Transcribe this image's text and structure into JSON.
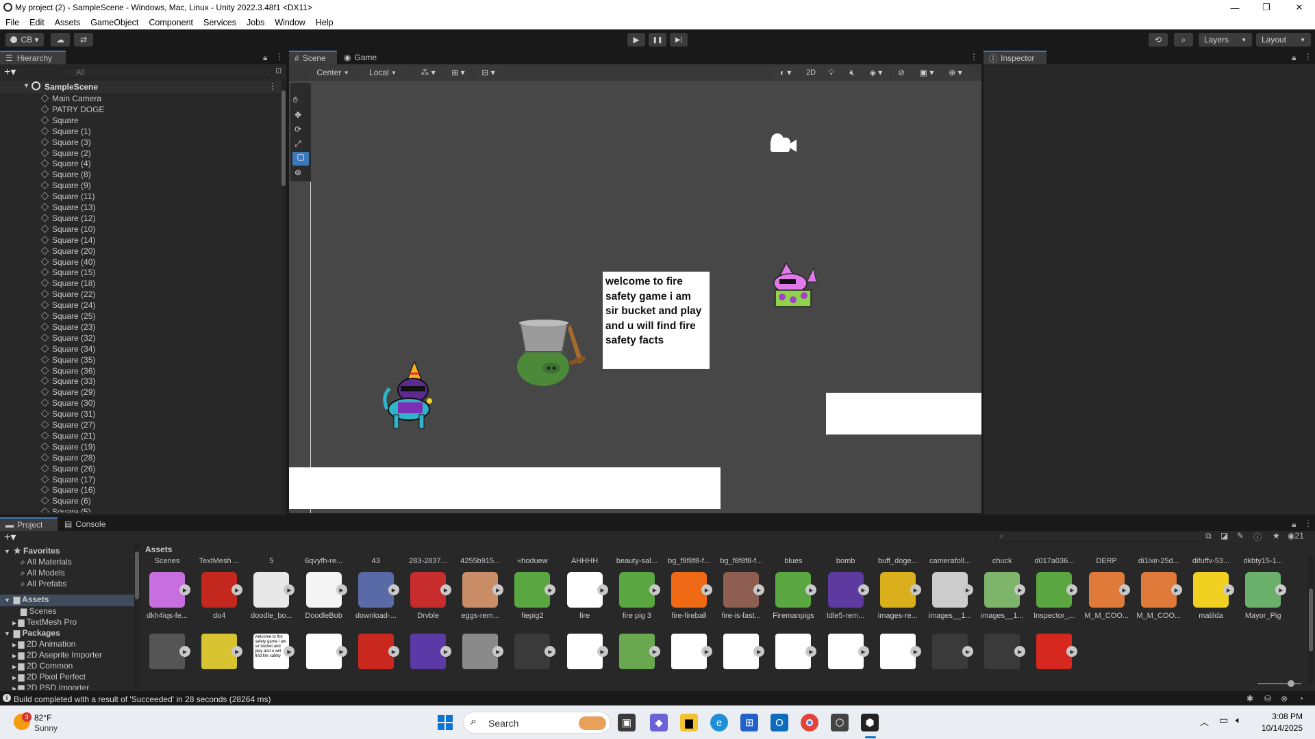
{
  "window": {
    "title": "My project (2) - SampleScene - Windows, Mac, Linux - Unity 2022.3.48f1 <DX11>",
    "minimize": "—",
    "maximize": "❐",
    "close": "✕"
  },
  "menu": [
    "File",
    "Edit",
    "Assets",
    "GameObject",
    "Component",
    "Services",
    "Jobs",
    "Window",
    "Help"
  ],
  "toolbar": {
    "account": "CB ▾",
    "cloud": "☁",
    "collab": "⇄",
    "play": "▶",
    "pause": "❚❚",
    "step": "▶|",
    "history": "⟲",
    "search": "⌕",
    "layers": "Layers",
    "layout": "Layout"
  },
  "hierarchy": {
    "tab": "Hierarchy",
    "search_placeholder": "All",
    "scene": "SampleScene",
    "items": [
      "Main Camera",
      "PATRY DOGE",
      "Square",
      "Square (1)",
      "Square (3)",
      "Square (2)",
      "Square (4)",
      "Square (8)",
      "Square (9)",
      "Square (11)",
      "Square (13)",
      "Square (12)",
      "Square (10)",
      "Square (14)",
      "Square (20)",
      "Square (40)",
      "Square (15)",
      "Square (18)",
      "Square (22)",
      "Square (24)",
      "Square (25)",
      "Square (23)",
      "Square (32)",
      "Square (34)",
      "Square (35)",
      "Square (36)",
      "Square (33)",
      "Square (29)",
      "Square (30)",
      "Square (31)",
      "Square (27)",
      "Square (21)",
      "Square (19)",
      "Square (28)",
      "Square (26)",
      "Square (17)",
      "Square (16)",
      "Square (6)",
      "Square (5)"
    ]
  },
  "scene_view": {
    "tab_scene": "Scene",
    "tab_game": "Game",
    "pivot": "Center",
    "space": "Local",
    "mode2d": "2D",
    "textbox": "welcome to fire safety game i am sir bucket and play and u will find fire safety facts"
  },
  "inspector": {
    "tab": "Inspector"
  },
  "project": {
    "tab_project": "Project",
    "tab_console": "Console",
    "breadcrumb": "Assets",
    "favorites": {
      "title": "Favorites",
      "items": [
        "All Materials",
        "All Models",
        "All Prefabs"
      ]
    },
    "assets_tree": {
      "title": "Assets",
      "items": [
        "Scenes",
        "TextMesh Pro"
      ]
    },
    "packages": {
      "title": "Packages",
      "items": [
        "2D Animation",
        "2D Aseprite Importer",
        "2D Common",
        "2D Pixel Perfect",
        "2D PSD Importer"
      ]
    },
    "top_labels": [
      "Scenes",
      "TextMesh ...",
      "5",
      "6qvyfh-re...",
      "43",
      "283-2837...",
      "4255b915...",
      "«hoduew",
      "AHHHH",
      "beauty-sal...",
      "bg_f8f8f8-f...",
      "bg_f8f8f8-f...",
      "blues",
      "bomb",
      "buff_doge...",
      "camerafoll...",
      "chuck",
      "d017a036...",
      "DERP",
      "di1ixir-25d...",
      "difuffv-53...",
      "dkbty15-1..."
    ],
    "row1": [
      "dkh4iqs-fe...",
      "do4",
      "doodle_bo...",
      "DoodleBob",
      "download-...",
      "Drvble",
      "eggs-rem...",
      "fiepig2",
      "fire",
      "fire pig 3",
      "fire-fireball",
      "fire-is-fast...",
      "Firemanpigs",
      "Idle5-rem...",
      "images-re...",
      "images__1...",
      "images__1...",
      "Inspector_...",
      "M_M_COO...",
      "M_M_COO...",
      "matilda",
      "Mayor_Pig"
    ],
    "count": "21",
    "textasset_thumb": "welcome to fire safety game i am sir bucket and play and u will find fire safety"
  },
  "status": {
    "message": "Build completed with a result of 'Succeeded' in 28 seconds (28264 ms)"
  },
  "taskbar": {
    "weather_badge": "3",
    "temp": "82°F",
    "condition": "Sunny",
    "search": "Search",
    "time": "3:08 PM",
    "date": "10/14/2025"
  },
  "colors": {
    "accent": "#3a79bb",
    "panel": "#282828",
    "scene": "#474747"
  }
}
